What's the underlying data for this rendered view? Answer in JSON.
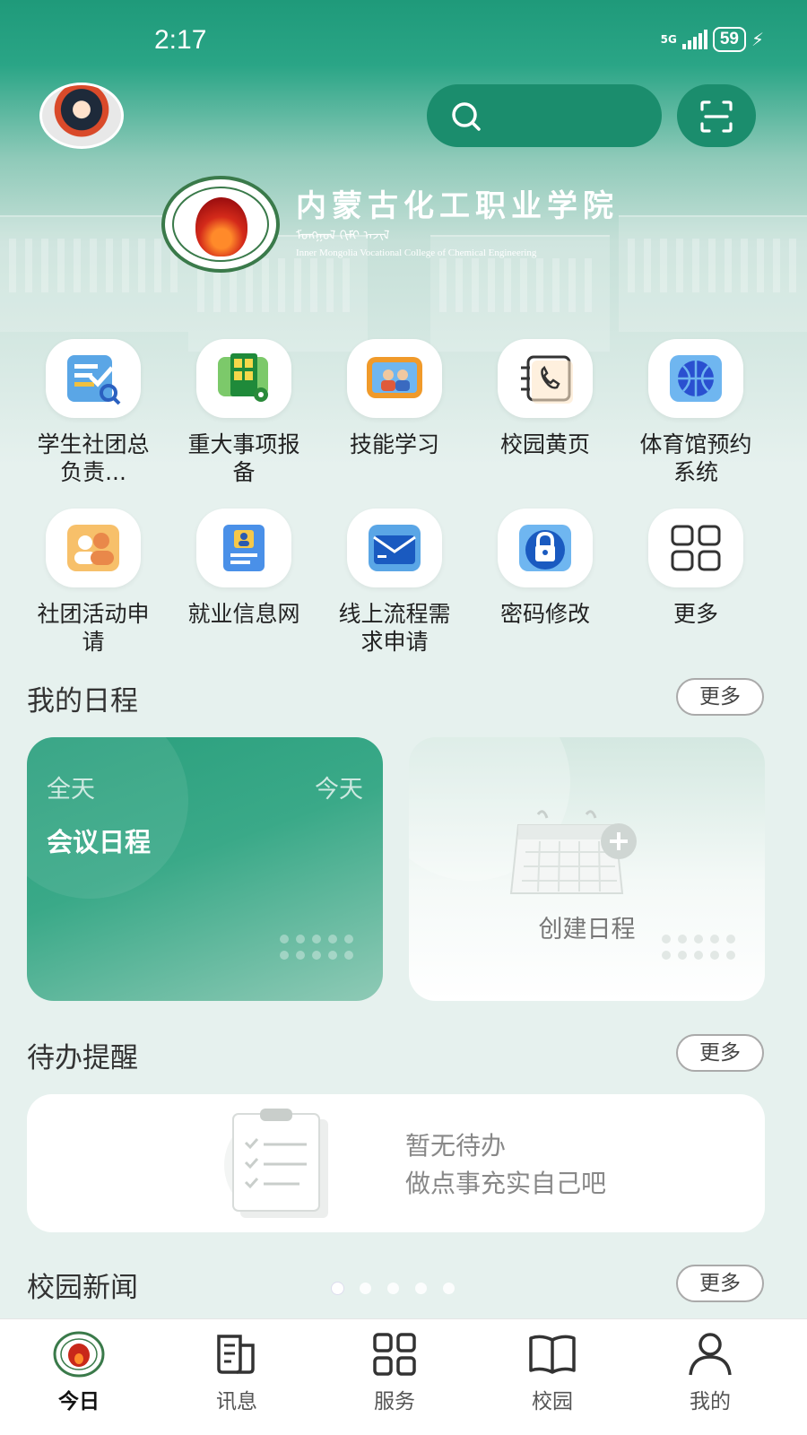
{
  "status_bar": {
    "time": "2:17",
    "network": "5G",
    "battery": "59"
  },
  "header": {
    "college_name": "内蒙古化工职业学院",
    "college_mongolian": "ᠮᠣᠩᠭᠣᠯ ᠬᠢᠮᠢ ᠠᠵᠢᠯ",
    "college_english": "Inner Mongolia Vocational College of Chemical Engineering"
  },
  "services": [
    {
      "label": "学生社团总负责...",
      "icon": "clipboard-check-icon"
    },
    {
      "label": "重大事项报备",
      "icon": "report-grid-icon"
    },
    {
      "label": "技能学习",
      "icon": "video-learning-icon"
    },
    {
      "label": "校园黄页",
      "icon": "phone-book-icon"
    },
    {
      "label": "体育馆预约系统",
      "icon": "basketball-icon"
    },
    {
      "label": "社团活动申请",
      "icon": "group-people-icon"
    },
    {
      "label": "就业信息网",
      "icon": "id-card-icon"
    },
    {
      "label": "线上流程需求申请",
      "icon": "envelope-icon"
    },
    {
      "label": "密码修改",
      "icon": "lock-icon"
    },
    {
      "label": "更多",
      "icon": "more-grid-icon"
    }
  ],
  "schedule": {
    "title": "我的日程",
    "more": "更多",
    "card": {
      "all_day": "全天",
      "day": "今天",
      "event": "会议日程"
    },
    "create": "创建日程"
  },
  "todo": {
    "title": "待办提醒",
    "more": "更多",
    "empty_line1": "暂无待办",
    "empty_line2": "做点事充实自己吧"
  },
  "news": {
    "title": "校园新闻",
    "more": "更多"
  },
  "tabbar": [
    {
      "label": "今日",
      "icon": "college-logo-icon",
      "active": true
    },
    {
      "label": "讯息",
      "icon": "message-icon",
      "active": false
    },
    {
      "label": "服务",
      "icon": "grid-icon",
      "active": false
    },
    {
      "label": "校园",
      "icon": "book-icon",
      "active": false
    },
    {
      "label": "我的",
      "icon": "person-icon",
      "active": false
    }
  ],
  "colors": {
    "brand_green": "#1f9a7a",
    "dark_green": "#1b8d6d"
  }
}
